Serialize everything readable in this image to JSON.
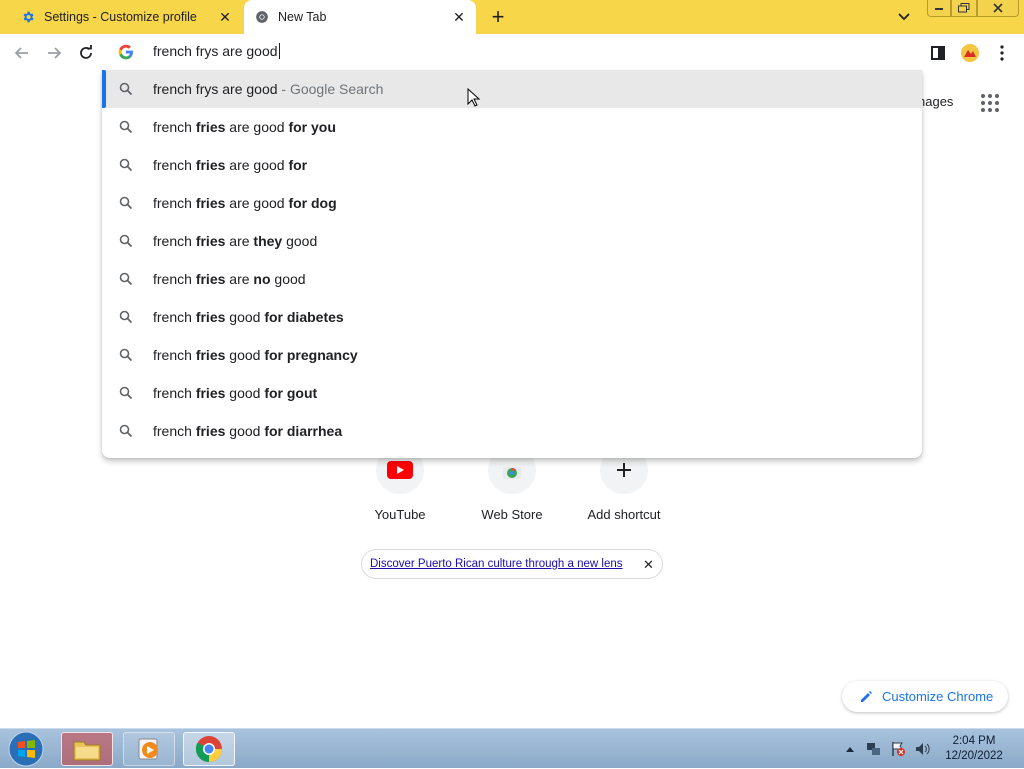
{
  "tabs": [
    {
      "title": "Settings - Customize profile",
      "icon": "gear-icon",
      "active": false
    },
    {
      "title": "New Tab",
      "icon": "chrome-icon",
      "active": true
    }
  ],
  "omnibox": {
    "text": "french frys are good"
  },
  "suggestions": [
    {
      "parts": [
        [
          "n",
          "french frys are good"
        ],
        [
          "s",
          " - Google Search"
        ]
      ],
      "selected": true
    },
    {
      "parts": [
        [
          "n",
          "french "
        ],
        [
          "b",
          "fries"
        ],
        [
          "n",
          " are good "
        ],
        [
          "b",
          "for you"
        ]
      ]
    },
    {
      "parts": [
        [
          "n",
          "french "
        ],
        [
          "b",
          "fries"
        ],
        [
          "n",
          " are good "
        ],
        [
          "b",
          "for"
        ]
      ]
    },
    {
      "parts": [
        [
          "n",
          "french "
        ],
        [
          "b",
          "fries"
        ],
        [
          "n",
          " are good "
        ],
        [
          "b",
          "for dog"
        ]
      ]
    },
    {
      "parts": [
        [
          "n",
          "french "
        ],
        [
          "b",
          "fries"
        ],
        [
          "n",
          " are "
        ],
        [
          "b",
          "they"
        ],
        [
          "n",
          " good"
        ]
      ]
    },
    {
      "parts": [
        [
          "n",
          "french "
        ],
        [
          "b",
          "fries"
        ],
        [
          "n",
          " are "
        ],
        [
          "b",
          "no"
        ],
        [
          "n",
          " good"
        ]
      ]
    },
    {
      "parts": [
        [
          "n",
          "french "
        ],
        [
          "b",
          "fries"
        ],
        [
          "n",
          " good "
        ],
        [
          "b",
          "for diabetes"
        ]
      ]
    },
    {
      "parts": [
        [
          "n",
          "french "
        ],
        [
          "b",
          "fries"
        ],
        [
          "n",
          " good "
        ],
        [
          "b",
          "for pregnancy"
        ]
      ]
    },
    {
      "parts": [
        [
          "n",
          "french "
        ],
        [
          "b",
          "fries"
        ],
        [
          "n",
          " good "
        ],
        [
          "b",
          "for gout"
        ]
      ]
    },
    {
      "parts": [
        [
          "n",
          "french "
        ],
        [
          "b",
          "fries"
        ],
        [
          "n",
          " good "
        ],
        [
          "b",
          "for diarrhea"
        ]
      ]
    }
  ],
  "ntp": {
    "images_label": "nages",
    "shortcuts": [
      {
        "label": "YouTube",
        "icon": "youtube-icon"
      },
      {
        "label": "Web Store",
        "icon": "webstore-icon"
      },
      {
        "label": "Add shortcut",
        "icon": "plus-icon"
      }
    ],
    "promo_text": "Discover Puerto Rican culture through a new lens",
    "customize_label": "Customize Chrome"
  },
  "taskbar": {
    "apps": [
      "windows-explorer-icon",
      "media-player-icon",
      "chrome-icon"
    ],
    "time": "2:04 PM",
    "date": "12/20/2022"
  },
  "colors": {
    "tabstrip": "#f7d64a",
    "accent": "#1a73e8",
    "selected_row": "#e8e8e8"
  }
}
